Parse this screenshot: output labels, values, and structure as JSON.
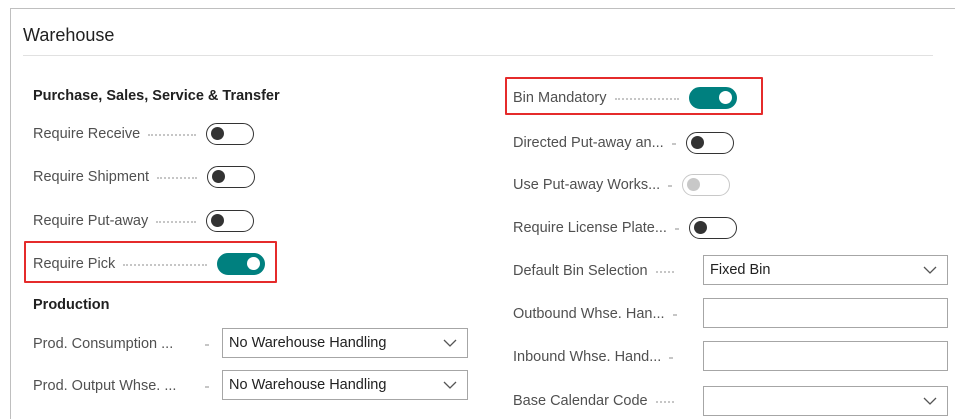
{
  "card": {
    "title": "Warehouse"
  },
  "left": {
    "group1_title": "Purchase, Sales, Service & Transfer",
    "toggles": [
      {
        "label": "Require Receive",
        "state": "off"
      },
      {
        "label": "Require Shipment",
        "state": "off"
      },
      {
        "label": "Require Put-away",
        "state": "off"
      },
      {
        "label": "Require Pick",
        "state": "on"
      }
    ],
    "group2_title": "Production",
    "selects": [
      {
        "label": "Prod. Consumption ...",
        "value": "No Warehouse Handling"
      },
      {
        "label": "Prod. Output Whse. ...",
        "value": "No Warehouse Handling"
      }
    ]
  },
  "right": {
    "toggles": [
      {
        "label": "Bin Mandatory",
        "state": "on"
      },
      {
        "label": "Directed Put-away an...",
        "state": "off"
      },
      {
        "label": "Use Put-away Works...",
        "state": "disabled"
      },
      {
        "label": "Require License Plate...",
        "state": "off"
      }
    ],
    "fields": [
      {
        "label": "Default Bin Selection",
        "value": "Fixed Bin",
        "kind": "select"
      },
      {
        "label": "Outbound Whse. Han...",
        "value": "",
        "kind": "text"
      },
      {
        "label": "Inbound Whse. Hand...",
        "value": "",
        "kind": "text"
      },
      {
        "label": "Base Calendar Code",
        "value": "",
        "kind": "select"
      }
    ]
  },
  "colors": {
    "accent": "#00807f",
    "highlight": "#e52b2b"
  },
  "icons": {
    "dropdown": "chevron-down-icon"
  }
}
